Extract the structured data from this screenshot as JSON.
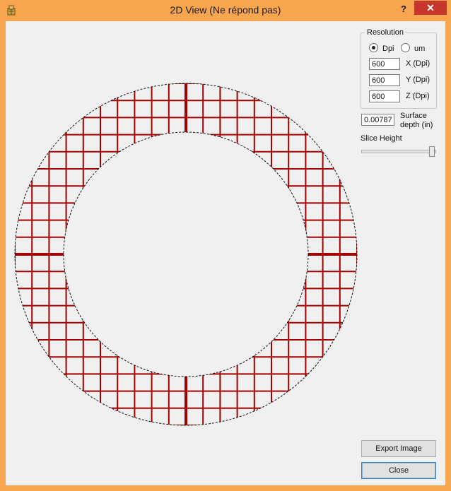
{
  "window": {
    "title": "2D View (Ne répond pas)",
    "help_glyph": "?",
    "close_glyph": "✕"
  },
  "resolution": {
    "group_label": "Resolution",
    "unit_options": [
      "Dpi",
      "um"
    ],
    "selected_unit": "Dpi",
    "x_value": "600",
    "x_label": "X (Dpi)",
    "y_value": "600",
    "y_label": "Y (Dpi)",
    "z_value": "600",
    "z_label": "Z (Dpi)"
  },
  "surface": {
    "value": "0.00787",
    "label_line1": "Surface",
    "label_line2": "depth (in)"
  },
  "slice": {
    "label": "Slice Height",
    "level_fraction": 1.0
  },
  "buttons": {
    "export": "Export Image",
    "close": "Close"
  },
  "colors": {
    "grid": "#a30000",
    "titlebar": "#f7a54e",
    "close_button": "#c7362b"
  }
}
